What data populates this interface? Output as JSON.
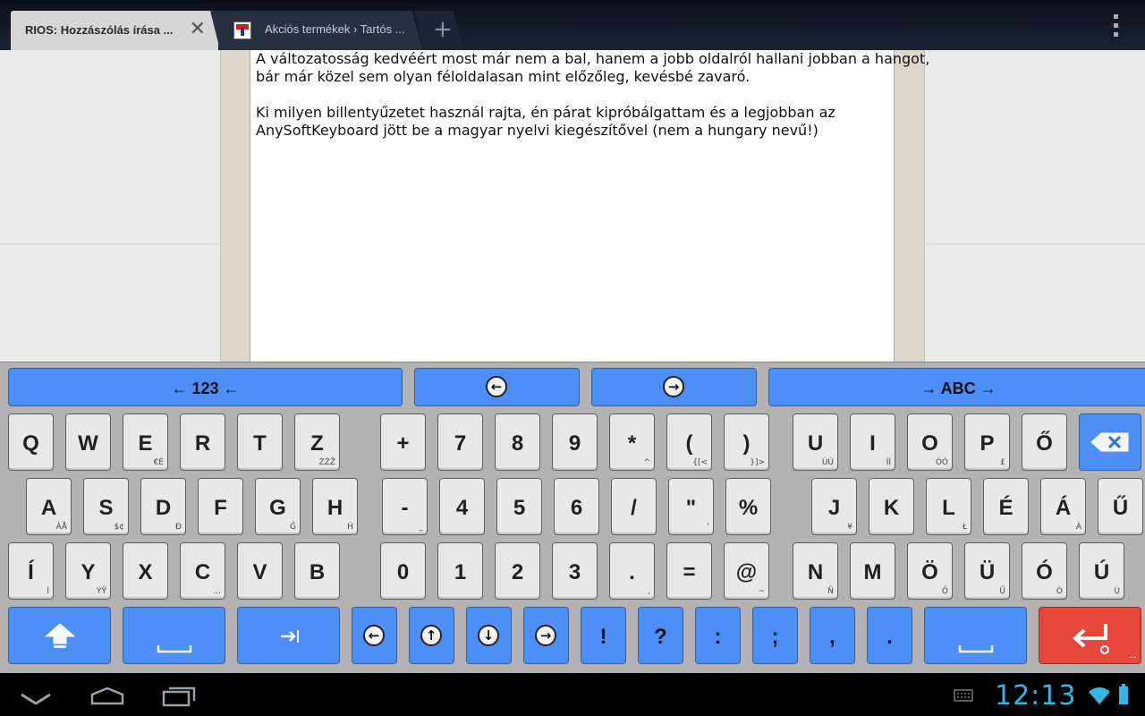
{
  "browser": {
    "tabs": [
      {
        "title": "RIOS: Hozzászólás írása ...",
        "active": true,
        "close_icon": "close-icon"
      },
      {
        "title": "Akciós termékek › Tartós ...",
        "active": false,
        "favicon": "site-favicon"
      }
    ],
    "new_tab_icon": "plus-icon",
    "menu_icon": "overflow-menu-icon"
  },
  "editor": {
    "lines": [
      "A változatosság kedvéért most már nem a bal, hanem a jobb oldalról hallani jobban a hangot,",
      "bár már közel sem olyan féloldalasan mint előzőleg, kevésbé zavaró.",
      "",
      "Ki milyen billentyűzetet használ rajta, én párat kipróbálgattam és a legjobban az",
      "AnySoftKeyboard jött be a magyar nyelvi kiegészítővel (nem a hungary nevű!)"
    ]
  },
  "keyboard": {
    "top_bar": {
      "left_label": "← 123 ←",
      "right_label": "→ ABC →",
      "prev_icon": "arrow-left-icon",
      "next_icon": "arrow-right-icon"
    },
    "row1": [
      {
        "m": "Q",
        "h": ""
      },
      {
        "m": "W",
        "h": ""
      },
      {
        "m": "E",
        "h": "€É"
      },
      {
        "m": "R",
        "h": ""
      },
      {
        "m": "T",
        "h": ""
      },
      {
        "m": "Z",
        "h": "ŹŻŽ"
      },
      {
        "m": "+",
        "h": ""
      },
      {
        "m": "7",
        "h": ""
      },
      {
        "m": "8",
        "h": ""
      },
      {
        "m": "9",
        "h": ""
      },
      {
        "m": "*",
        "h": "^"
      },
      {
        "m": "(",
        "h": "{[<"
      },
      {
        "m": ")",
        "h": "}]>"
      },
      {
        "m": "U",
        "h": "ÙÚ"
      },
      {
        "m": "I",
        "h": "ÌÍ"
      },
      {
        "m": "O",
        "h": "ÒÓ"
      },
      {
        "m": "P",
        "h": "£"
      },
      {
        "m": "Ő",
        "h": ""
      }
    ],
    "row2": [
      {
        "m": "A",
        "h": "ÀÅ"
      },
      {
        "m": "S",
        "h": "$¢"
      },
      {
        "m": "D",
        "h": "Đ"
      },
      {
        "m": "F",
        "h": ""
      },
      {
        "m": "G",
        "h": "Ĝ"
      },
      {
        "m": "H",
        "h": "Ĥ"
      },
      {
        "m": "-",
        "h": "_"
      },
      {
        "m": "4",
        "h": ""
      },
      {
        "m": "5",
        "h": ""
      },
      {
        "m": "6",
        "h": ""
      },
      {
        "m": "/",
        "h": ""
      },
      {
        "m": "\"",
        "h": "'"
      },
      {
        "m": "%",
        "h": ""
      },
      {
        "m": "J",
        "h": "¥"
      },
      {
        "m": "K",
        "h": ""
      },
      {
        "m": "L",
        "h": "Ł"
      },
      {
        "m": "É",
        "h": ""
      },
      {
        "m": "Á",
        "h": "À"
      },
      {
        "m": "Ű",
        "h": ""
      }
    ],
    "row3": [
      {
        "m": "Í",
        "h": "Ì"
      },
      {
        "m": "Y",
        "h": "ÝŸ"
      },
      {
        "m": "X",
        "h": ""
      },
      {
        "m": "C",
        "h": "..."
      },
      {
        "m": "V",
        "h": ""
      },
      {
        "m": "B",
        "h": ""
      },
      {
        "m": "0",
        "h": ""
      },
      {
        "m": "1",
        "h": ""
      },
      {
        "m": "2",
        "h": ""
      },
      {
        "m": "3",
        "h": ""
      },
      {
        "m": ".",
        "h": ","
      },
      {
        "m": "=",
        "h": ""
      },
      {
        "m": "@",
        "h": "~"
      },
      {
        "m": "N",
        "h": "Ñ"
      },
      {
        "m": "M",
        "h": ""
      },
      {
        "m": "Ö",
        "h": "Ő"
      },
      {
        "m": "Ü",
        "h": "Ű"
      },
      {
        "m": "Ó",
        "h": "Ò"
      },
      {
        "m": "Ú",
        "h": "Ù"
      }
    ],
    "row4_symbols": [
      "!",
      "?",
      ":",
      ";",
      ",",
      "."
    ],
    "enter_hint": "..."
  },
  "system_bar": {
    "clock": "12:13"
  },
  "colors": {
    "key_blue": "#4e8ef7",
    "key_red": "#e8473b",
    "clock": "#33b5e5"
  }
}
